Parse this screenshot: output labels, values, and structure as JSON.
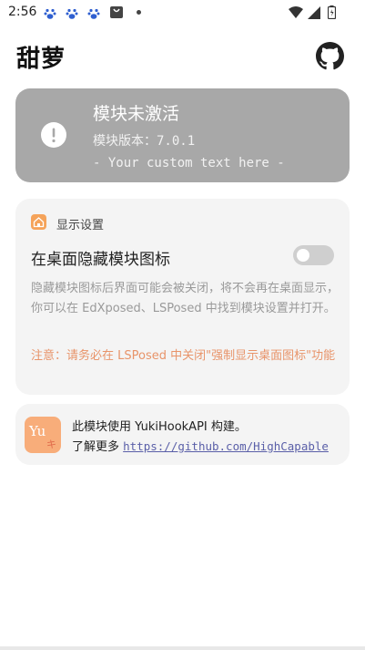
{
  "statusbar": {
    "time": "2:56",
    "icons": [
      "paw-icon",
      "paw-icon",
      "paw-icon",
      "shopping-bag-icon",
      "dot-icon",
      "wifi-icon",
      "signal-icon",
      "battery-icon"
    ]
  },
  "app": {
    "title": "甜萝",
    "github_icon": "github-icon"
  },
  "status_card": {
    "title": "模块未激活",
    "version": "模块版本：7.0.1",
    "custom_text": "- Your custom text here -",
    "icon": "exclamation-circle-icon",
    "color": "#a8a8a8"
  },
  "settings": {
    "section_title": "显示设置",
    "section_icon": "home-icon",
    "hide_icon": {
      "label": "在桌面隐藏模块图标",
      "enabled": false,
      "description": "隐藏模块图标后界面可能会被关闭，将不会再在桌面显示，你可以在 EdXposed、LSPosed 中找到模块设置并打开。",
      "warning": "注意：请务必在 LSPosed 中关闭\"强制显示桌面图标\"功能"
    }
  },
  "about": {
    "line1": "此模块使用 YukiHookAPI 构建。",
    "line2_prefix": "了解更多",
    "link": "https://github.com/HighCapable",
    "logo_text": "Yu",
    "logo_mark": "キ"
  },
  "colors": {
    "accent": "#f5a35a",
    "warning": "#e8946a",
    "link": "#5a5fa8"
  }
}
